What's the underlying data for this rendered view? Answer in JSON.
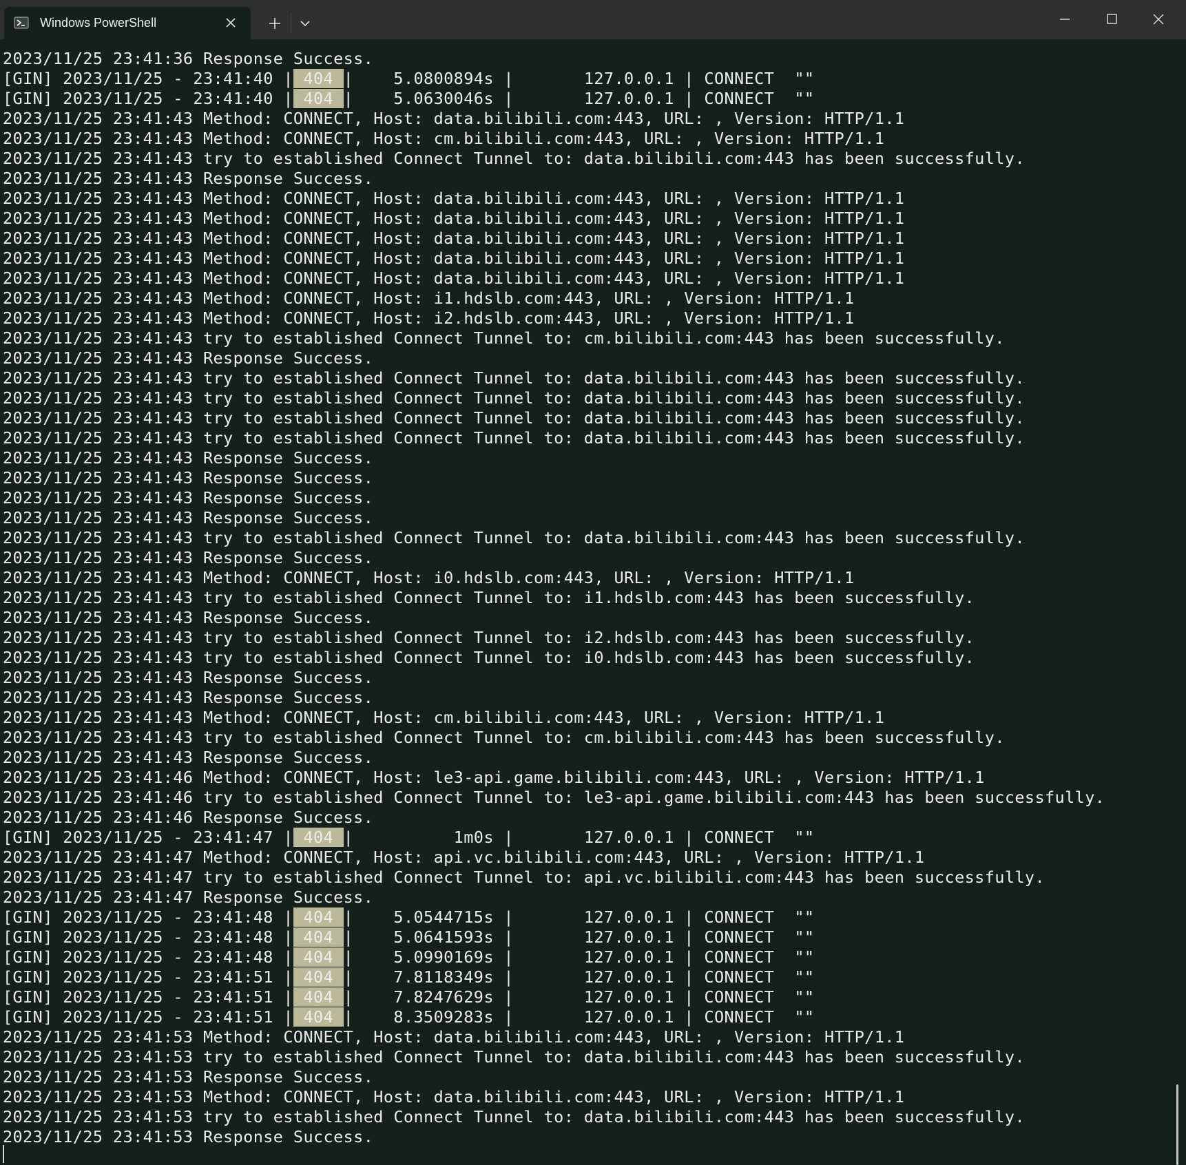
{
  "window": {
    "tab_title": "Windows PowerShell",
    "icons": {
      "tab": "powershell-icon",
      "close_tab": "close-icon",
      "new_tab": "plus-icon",
      "dropdown": "chevron-down-icon",
      "minimize": "minimize-icon",
      "maximize": "maximize-icon",
      "close_window": "close-icon"
    }
  },
  "colors": {
    "background": "#16201b",
    "titlebar": "#2d2f30",
    "text": "#ececec",
    "status_highlight": "#bcb89a"
  },
  "terminal": {
    "lines": [
      {
        "text": "2023/11/25 23:41:36 Response Success."
      },
      {
        "pre": "[GIN] 2023/11/25 - 23:41:40 |",
        "code": " 404 ",
        "post": "|    5.0800894s |       127.0.0.1 | CONNECT  \"\""
      },
      {
        "pre": "[GIN] 2023/11/25 - 23:41:40 |",
        "code": " 404 ",
        "post": "|    5.0630046s |       127.0.0.1 | CONNECT  \"\""
      },
      {
        "text": "2023/11/25 23:41:43 Method: CONNECT, Host: data.bilibili.com:443, URL: , Version: HTTP/1.1"
      },
      {
        "text": "2023/11/25 23:41:43 Method: CONNECT, Host: cm.bilibili.com:443, URL: , Version: HTTP/1.1"
      },
      {
        "text": "2023/11/25 23:41:43 try to established Connect Tunnel to: data.bilibili.com:443 has been successfully."
      },
      {
        "text": "2023/11/25 23:41:43 Response Success."
      },
      {
        "text": "2023/11/25 23:41:43 Method: CONNECT, Host: data.bilibili.com:443, URL: , Version: HTTP/1.1"
      },
      {
        "text": "2023/11/25 23:41:43 Method: CONNECT, Host: data.bilibili.com:443, URL: , Version: HTTP/1.1"
      },
      {
        "text": "2023/11/25 23:41:43 Method: CONNECT, Host: data.bilibili.com:443, URL: , Version: HTTP/1.1"
      },
      {
        "text": "2023/11/25 23:41:43 Method: CONNECT, Host: data.bilibili.com:443, URL: , Version: HTTP/1.1"
      },
      {
        "text": "2023/11/25 23:41:43 Method: CONNECT, Host: data.bilibili.com:443, URL: , Version: HTTP/1.1"
      },
      {
        "text": "2023/11/25 23:41:43 Method: CONNECT, Host: i1.hdslb.com:443, URL: , Version: HTTP/1.1"
      },
      {
        "text": "2023/11/25 23:41:43 Method: CONNECT, Host: i2.hdslb.com:443, URL: , Version: HTTP/1.1"
      },
      {
        "text": "2023/11/25 23:41:43 try to established Connect Tunnel to: cm.bilibili.com:443 has been successfully."
      },
      {
        "text": "2023/11/25 23:41:43 Response Success."
      },
      {
        "text": "2023/11/25 23:41:43 try to established Connect Tunnel to: data.bilibili.com:443 has been successfully."
      },
      {
        "text": "2023/11/25 23:41:43 try to established Connect Tunnel to: data.bilibili.com:443 has been successfully."
      },
      {
        "text": "2023/11/25 23:41:43 try to established Connect Tunnel to: data.bilibili.com:443 has been successfully."
      },
      {
        "text": "2023/11/25 23:41:43 try to established Connect Tunnel to: data.bilibili.com:443 has been successfully."
      },
      {
        "text": "2023/11/25 23:41:43 Response Success."
      },
      {
        "text": "2023/11/25 23:41:43 Response Success."
      },
      {
        "text": "2023/11/25 23:41:43 Response Success."
      },
      {
        "text": "2023/11/25 23:41:43 Response Success."
      },
      {
        "text": "2023/11/25 23:41:43 try to established Connect Tunnel to: data.bilibili.com:443 has been successfully."
      },
      {
        "text": "2023/11/25 23:41:43 Response Success."
      },
      {
        "text": "2023/11/25 23:41:43 Method: CONNECT, Host: i0.hdslb.com:443, URL: , Version: HTTP/1.1"
      },
      {
        "text": "2023/11/25 23:41:43 try to established Connect Tunnel to: i1.hdslb.com:443 has been successfully."
      },
      {
        "text": "2023/11/25 23:41:43 Response Success."
      },
      {
        "text": "2023/11/25 23:41:43 try to established Connect Tunnel to: i2.hdslb.com:443 has been successfully."
      },
      {
        "text": "2023/11/25 23:41:43 try to established Connect Tunnel to: i0.hdslb.com:443 has been successfully."
      },
      {
        "text": "2023/11/25 23:41:43 Response Success."
      },
      {
        "text": "2023/11/25 23:41:43 Response Success."
      },
      {
        "text": "2023/11/25 23:41:43 Method: CONNECT, Host: cm.bilibili.com:443, URL: , Version: HTTP/1.1"
      },
      {
        "text": "2023/11/25 23:41:43 try to established Connect Tunnel to: cm.bilibili.com:443 has been successfully."
      },
      {
        "text": "2023/11/25 23:41:43 Response Success."
      },
      {
        "text": "2023/11/25 23:41:46 Method: CONNECT, Host: le3-api.game.bilibili.com:443, URL: , Version: HTTP/1.1"
      },
      {
        "text": "2023/11/25 23:41:46 try to established Connect Tunnel to: le3-api.game.bilibili.com:443 has been successfully."
      },
      {
        "text": "2023/11/25 23:41:46 Response Success."
      },
      {
        "pre": "[GIN] 2023/11/25 - 23:41:47 |",
        "code": " 404 ",
        "post": "|          1m0s |       127.0.0.1 | CONNECT  \"\""
      },
      {
        "text": "2023/11/25 23:41:47 Method: CONNECT, Host: api.vc.bilibili.com:443, URL: , Version: HTTP/1.1"
      },
      {
        "text": "2023/11/25 23:41:47 try to established Connect Tunnel to: api.vc.bilibili.com:443 has been successfully."
      },
      {
        "text": "2023/11/25 23:41:47 Response Success."
      },
      {
        "pre": "[GIN] 2023/11/25 - 23:41:48 |",
        "code": " 404 ",
        "post": "|    5.0544715s |       127.0.0.1 | CONNECT  \"\""
      },
      {
        "pre": "[GIN] 2023/11/25 - 23:41:48 |",
        "code": " 404 ",
        "post": "|    5.0641593s |       127.0.0.1 | CONNECT  \"\""
      },
      {
        "pre": "[GIN] 2023/11/25 - 23:41:48 |",
        "code": " 404 ",
        "post": "|    5.0990169s |       127.0.0.1 | CONNECT  \"\""
      },
      {
        "pre": "[GIN] 2023/11/25 - 23:41:51 |",
        "code": " 404 ",
        "post": "|    7.8118349s |       127.0.0.1 | CONNECT  \"\""
      },
      {
        "pre": "[GIN] 2023/11/25 - 23:41:51 |",
        "code": " 404 ",
        "post": "|    7.8247629s |       127.0.0.1 | CONNECT  \"\""
      },
      {
        "pre": "[GIN] 2023/11/25 - 23:41:51 |",
        "code": " 404 ",
        "post": "|    8.3509283s |       127.0.0.1 | CONNECT  \"\""
      },
      {
        "text": "2023/11/25 23:41:53 Method: CONNECT, Host: data.bilibili.com:443, URL: , Version: HTTP/1.1"
      },
      {
        "text": "2023/11/25 23:41:53 try to established Connect Tunnel to: data.bilibili.com:443 has been successfully."
      },
      {
        "text": "2023/11/25 23:41:53 Response Success."
      },
      {
        "text": "2023/11/25 23:41:53 Method: CONNECT, Host: data.bilibili.com:443, URL: , Version: HTTP/1.1"
      },
      {
        "text": "2023/11/25 23:41:53 try to established Connect Tunnel to: data.bilibili.com:443 has been successfully."
      },
      {
        "text": "2023/11/25 23:41:53 Response Success."
      }
    ]
  }
}
